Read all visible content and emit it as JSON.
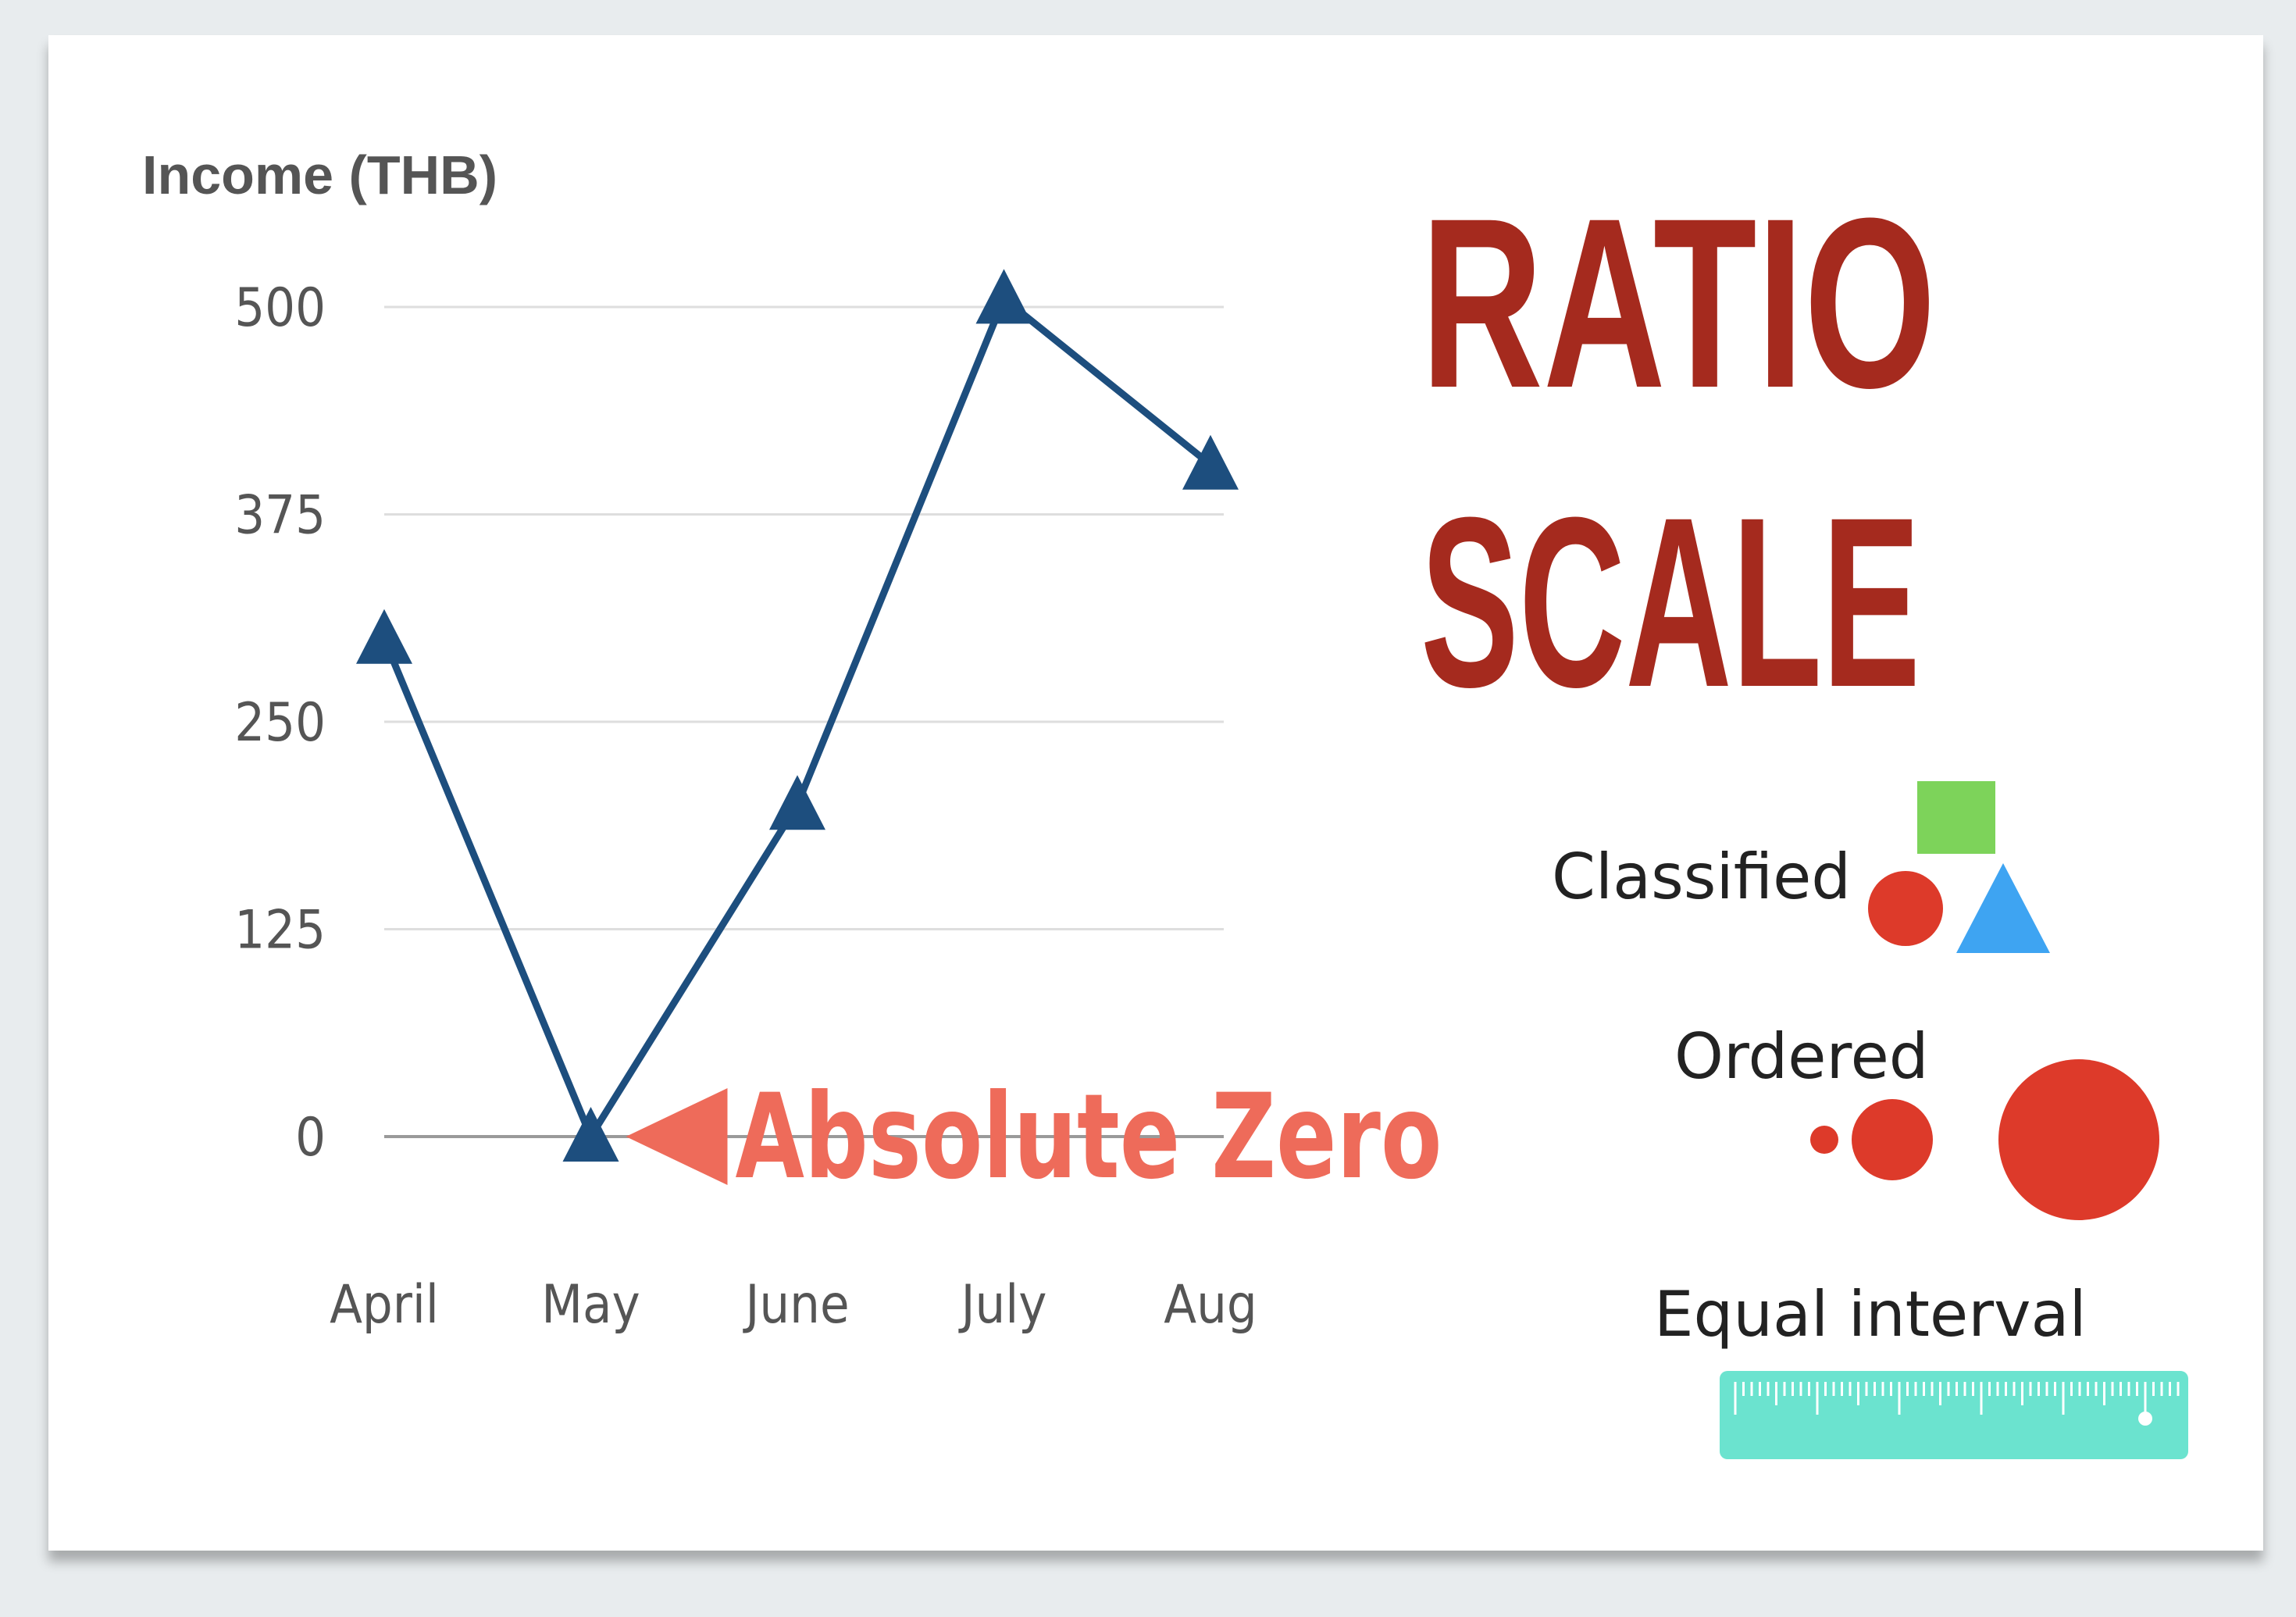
{
  "chart_data": {
    "type": "line",
    "title_line1": "RATIO",
    "title_line2": "SCALE",
    "ylabel": "Income (THB)",
    "categories": [
      "April",
      "May",
      "June",
      "July",
      "Aug"
    ],
    "values": [
      300,
      0,
      200,
      505,
      405
    ],
    "yticks": [
      0,
      125,
      250,
      375,
      500
    ],
    "ylim": [
      0,
      500
    ],
    "grid": true,
    "marker": "triangle",
    "line_color": "#1d4e7e",
    "annotation": {
      "text": "Absolute Zero",
      "color": "#ee6b5a",
      "target_category": "May",
      "target_value": 0
    }
  },
  "legend": {
    "classified": {
      "label": "Classified",
      "colors": [
        "#7dd35a",
        "#dd3a2a",
        "#3ea4f2"
      ]
    },
    "ordered": {
      "label": "Ordered",
      "color": "#dd3a2a"
    },
    "equal_interval": {
      "label": "Equal interval",
      "color": "#6be3cf"
    }
  },
  "colors": {
    "title": "#a52a1e",
    "grid": "#dedede",
    "axis": "#9a9a9a",
    "text": "#555555"
  }
}
